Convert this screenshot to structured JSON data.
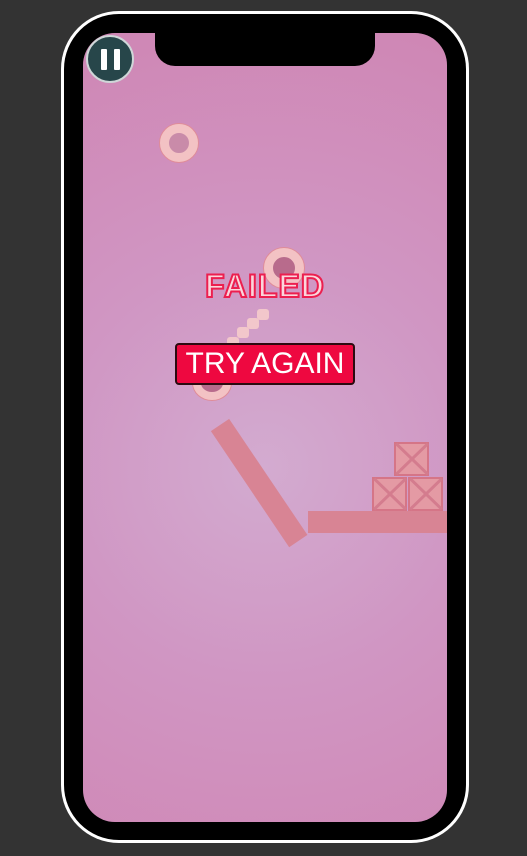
{
  "game": {
    "status_title": "FAILED",
    "retry_label": "TRY AGAIN"
  },
  "hud": {
    "pause_icon": "pause-icon"
  },
  "colors": {
    "background": "#333333",
    "screen_bg": "#d096c3",
    "retry_bg": "#ee0840",
    "failed_stroke": "#ec1f4f"
  }
}
